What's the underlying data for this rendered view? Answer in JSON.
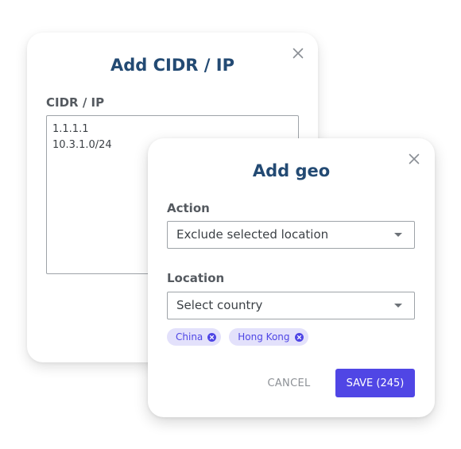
{
  "cidr_dialog": {
    "title": "Add CIDR / IP",
    "field_label": "CIDR / IP",
    "textarea_value": "1.1.1.1\n10.3.1.0/24"
  },
  "geo_dialog": {
    "title": "Add geo",
    "action_label": "Action",
    "action_value": "Exclude selected location",
    "location_label": "Location",
    "location_placeholder": "Select country",
    "chips": [
      {
        "label": "China"
      },
      {
        "label": "Hong Kong"
      }
    ],
    "cancel_label": "CANCEL",
    "save_label": "SAVE (245)"
  },
  "colors": {
    "title": "#234a73",
    "accent": "#5046e5",
    "chip_bg": "#e3e1fb"
  },
  "icons": {
    "close": "close-icon",
    "chevron": "chevron-down-icon",
    "chip_remove": "remove-chip-icon"
  }
}
